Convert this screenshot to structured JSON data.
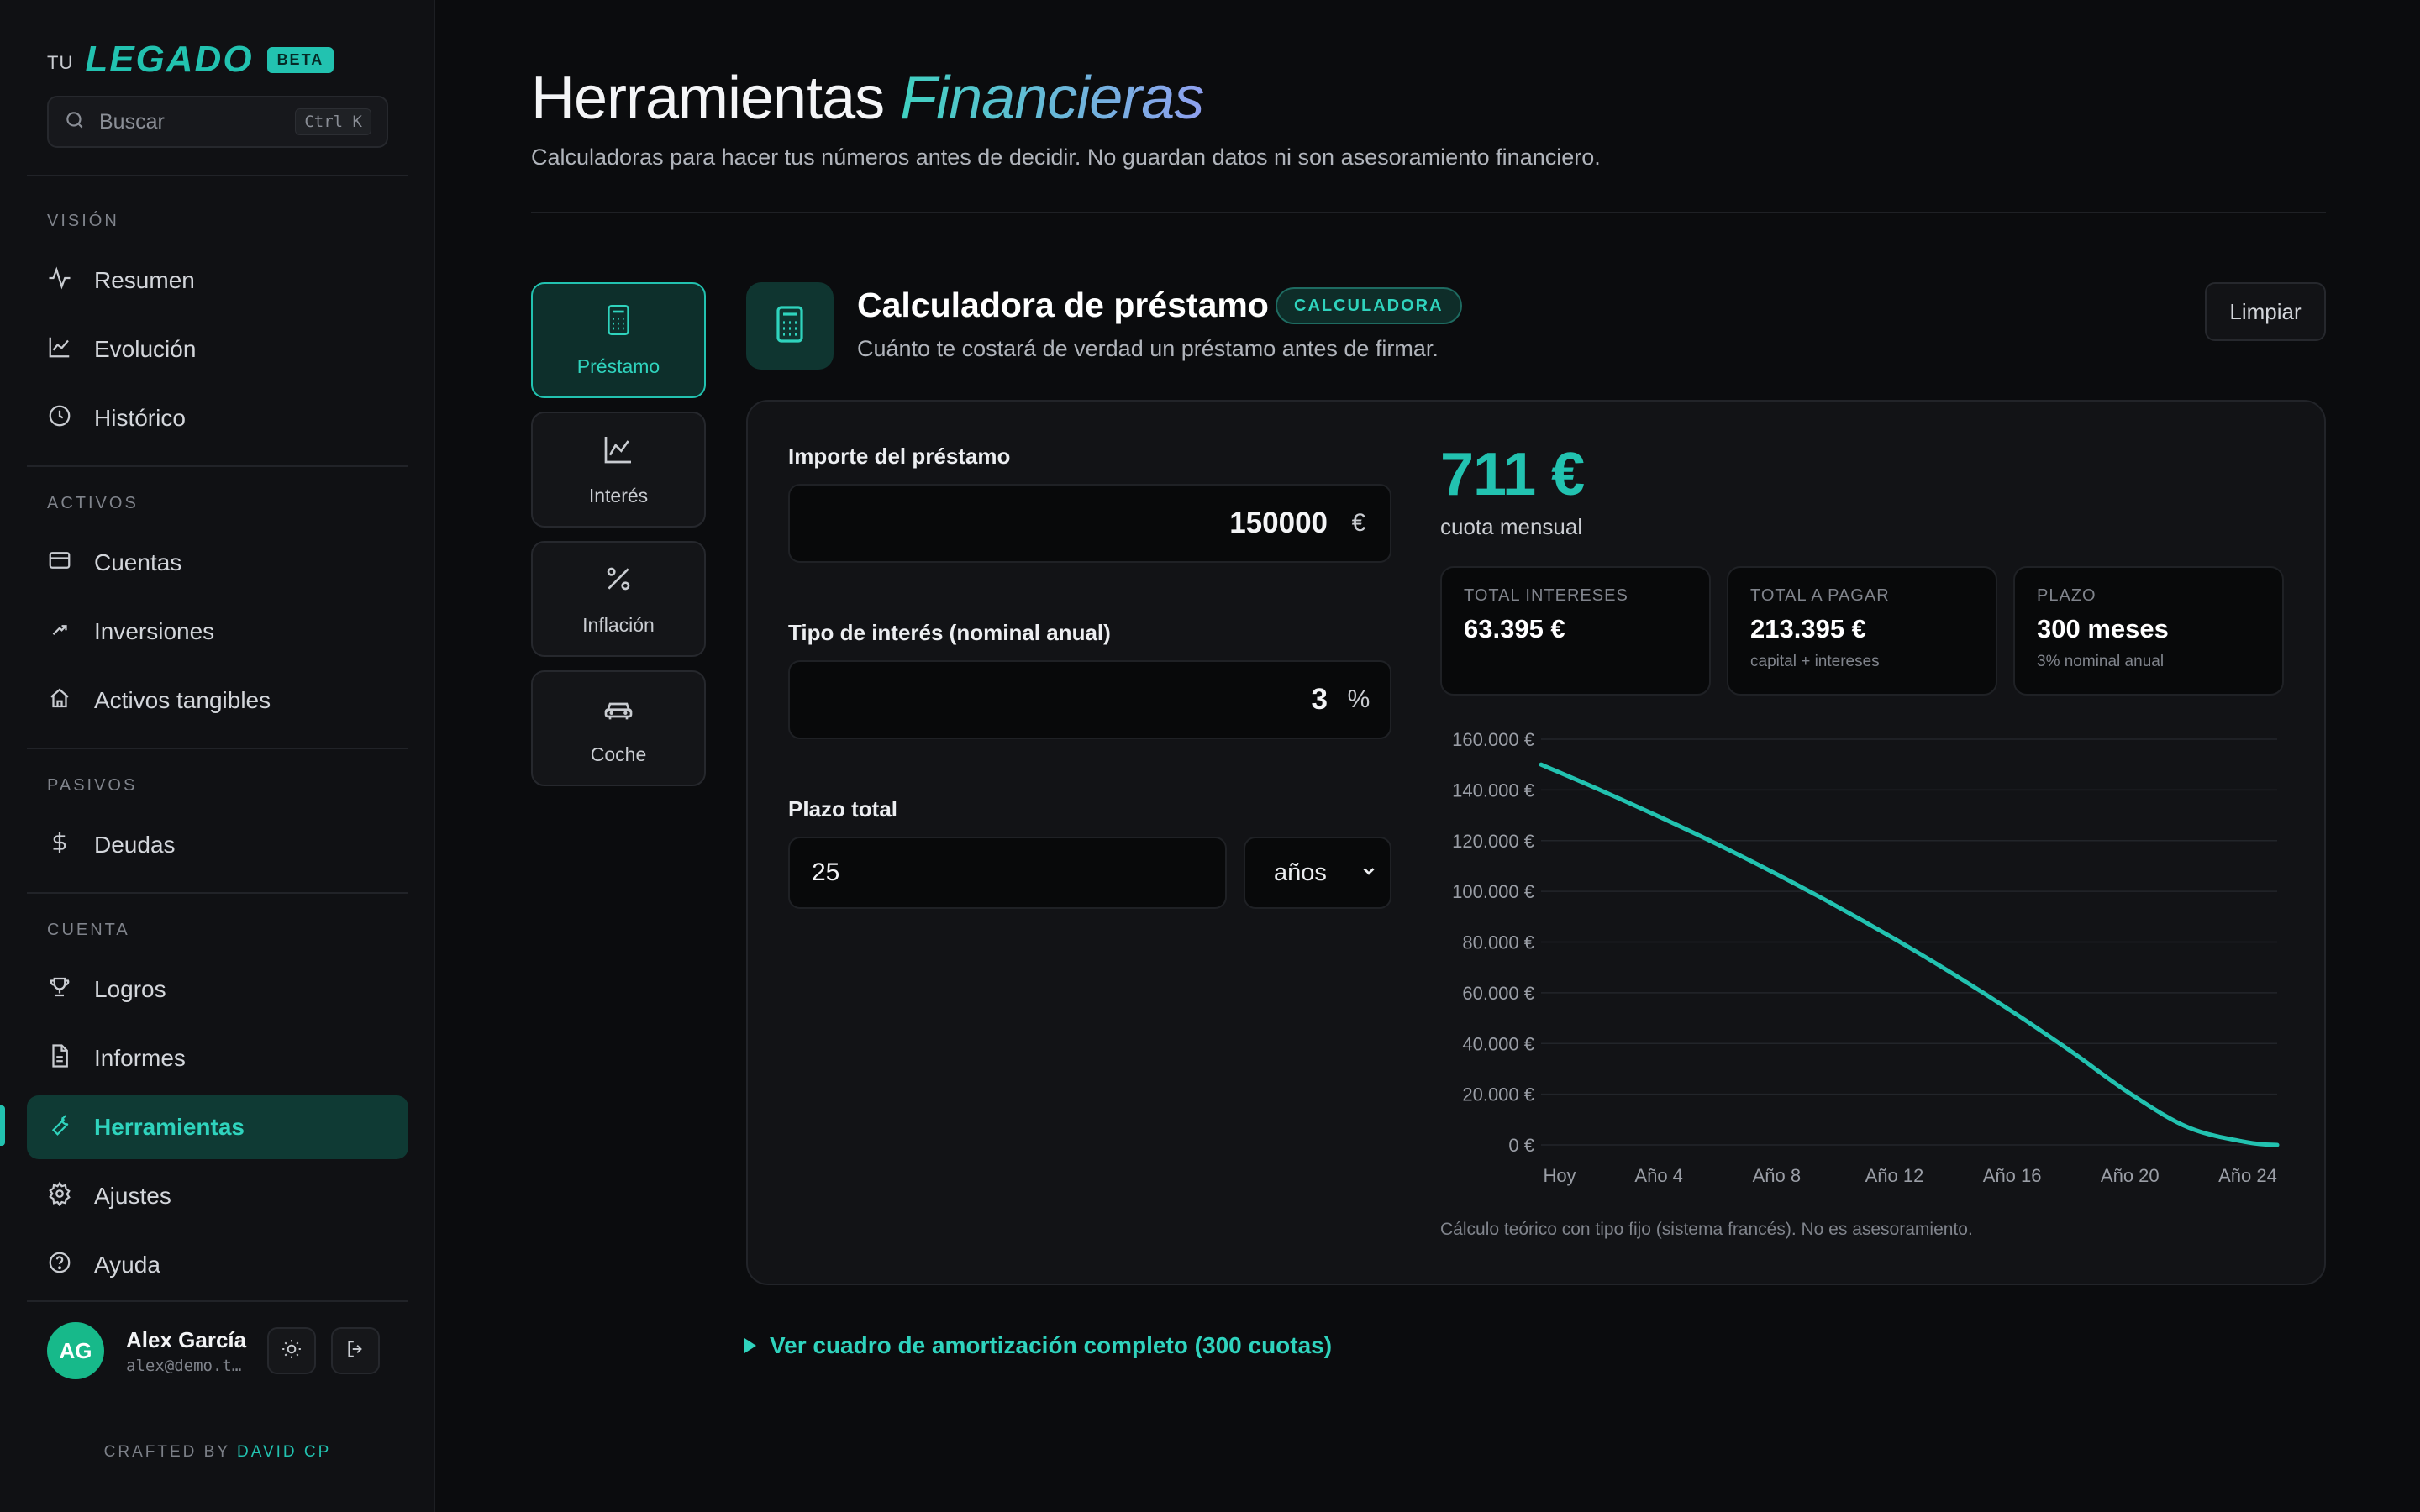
{
  "brand": {
    "tu": "TU",
    "name": "LEGADO",
    "badge": "BETA"
  },
  "search": {
    "placeholder": "Buscar",
    "shortcut": "Ctrl K"
  },
  "sidebar": {
    "sections": [
      {
        "label": "VISIÓN",
        "items": [
          {
            "label": "Resumen",
            "icon": "activity-icon"
          },
          {
            "label": "Evolución",
            "icon": "line-chart-icon"
          },
          {
            "label": "Histórico",
            "icon": "clock-icon"
          }
        ]
      },
      {
        "label": "ACTIVOS",
        "items": [
          {
            "label": "Cuentas",
            "icon": "card-icon"
          },
          {
            "label": "Inversiones",
            "icon": "trend-up-icon"
          },
          {
            "label": "Activos tangibles",
            "icon": "home-icon"
          }
        ]
      },
      {
        "label": "PASIVOS",
        "items": [
          {
            "label": "Deudas",
            "icon": "dollar-icon"
          }
        ]
      },
      {
        "label": "CUENTA",
        "items": [
          {
            "label": "Logros",
            "icon": "trophy-icon"
          },
          {
            "label": "Informes",
            "icon": "file-icon"
          },
          {
            "label": "Herramientas",
            "icon": "wrench-icon",
            "active": true
          },
          {
            "label": "Ajustes",
            "icon": "gear-icon"
          },
          {
            "label": "Ayuda",
            "icon": "help-icon"
          }
        ]
      }
    ]
  },
  "user": {
    "initials": "AG",
    "name": "Alex García",
    "email": "alex@demo.t…"
  },
  "crafted": {
    "prefix": "CRAFTED BY",
    "author": "DAVID CP"
  },
  "page": {
    "title_main": "Herramientas",
    "title_accent": "Financieras",
    "subtitle": "Calculadoras para hacer tus números antes de decidir. No guardan datos ni son asesoramiento financiero."
  },
  "tools": [
    {
      "label": "Préstamo",
      "icon": "calculator-icon",
      "active": true
    },
    {
      "label": "Interés",
      "icon": "area-chart-icon"
    },
    {
      "label": "Inflación",
      "icon": "percent-icon"
    },
    {
      "label": "Coche",
      "icon": "car-icon"
    }
  ],
  "calculator": {
    "title": "Calculadora de préstamo",
    "badge": "CALCULADORA",
    "subtitle": "Cuánto te costará de verdad un préstamo antes de firmar.",
    "clear_label": "Limpiar",
    "amount": {
      "label": "Importe del préstamo",
      "value": "150000",
      "unit": "€"
    },
    "rate": {
      "label": "Tipo de interés (nominal anual)",
      "value": "3",
      "unit": "%"
    },
    "term": {
      "label": "Plazo total",
      "value": "25",
      "unit_selected": "años"
    },
    "result": {
      "value": "711 €",
      "label": "cuota mensual"
    },
    "stats": [
      {
        "label": "TOTAL INTERESES",
        "value": "63.395 €",
        "sub": ""
      },
      {
        "label": "TOTAL A PAGAR",
        "value": "213.395 €",
        "sub": "capital + intereses"
      },
      {
        "label": "PLAZO",
        "value": "300 meses",
        "sub": "3% nominal anual"
      }
    ],
    "note": "Cálculo teórico con tipo fijo (sistema francés). No es asesoramiento.",
    "amortization_link": "Ver cuadro de amortización completo (300 cuotas)"
  },
  "chart_data": {
    "type": "line",
    "title": "",
    "xlabel": "",
    "ylabel": "",
    "x_tick_labels": [
      "Hoy",
      "Año 4",
      "Año 8",
      "Año 12",
      "Año 16",
      "Año 20",
      "Año 24"
    ],
    "y_tick_labels": [
      "160.000 €",
      "140.000 €",
      "120.000 €",
      "100.000 €",
      "80.000 €",
      "60.000 €",
      "40.000 €",
      "20.000 €",
      "0 €"
    ],
    "ylim": [
      0,
      160000
    ],
    "xlim": [
      0,
      25
    ],
    "grid": true,
    "color": "#22c2b0",
    "x": [
      0,
      2,
      4,
      6,
      8,
      10,
      12,
      14,
      16,
      18,
      20,
      22,
      24,
      25
    ],
    "values": [
      150000,
      140000,
      129500,
      118500,
      106800,
      94400,
      81300,
      67400,
      52600,
      36900,
      20300,
      6800,
      1000,
      0
    ]
  }
}
